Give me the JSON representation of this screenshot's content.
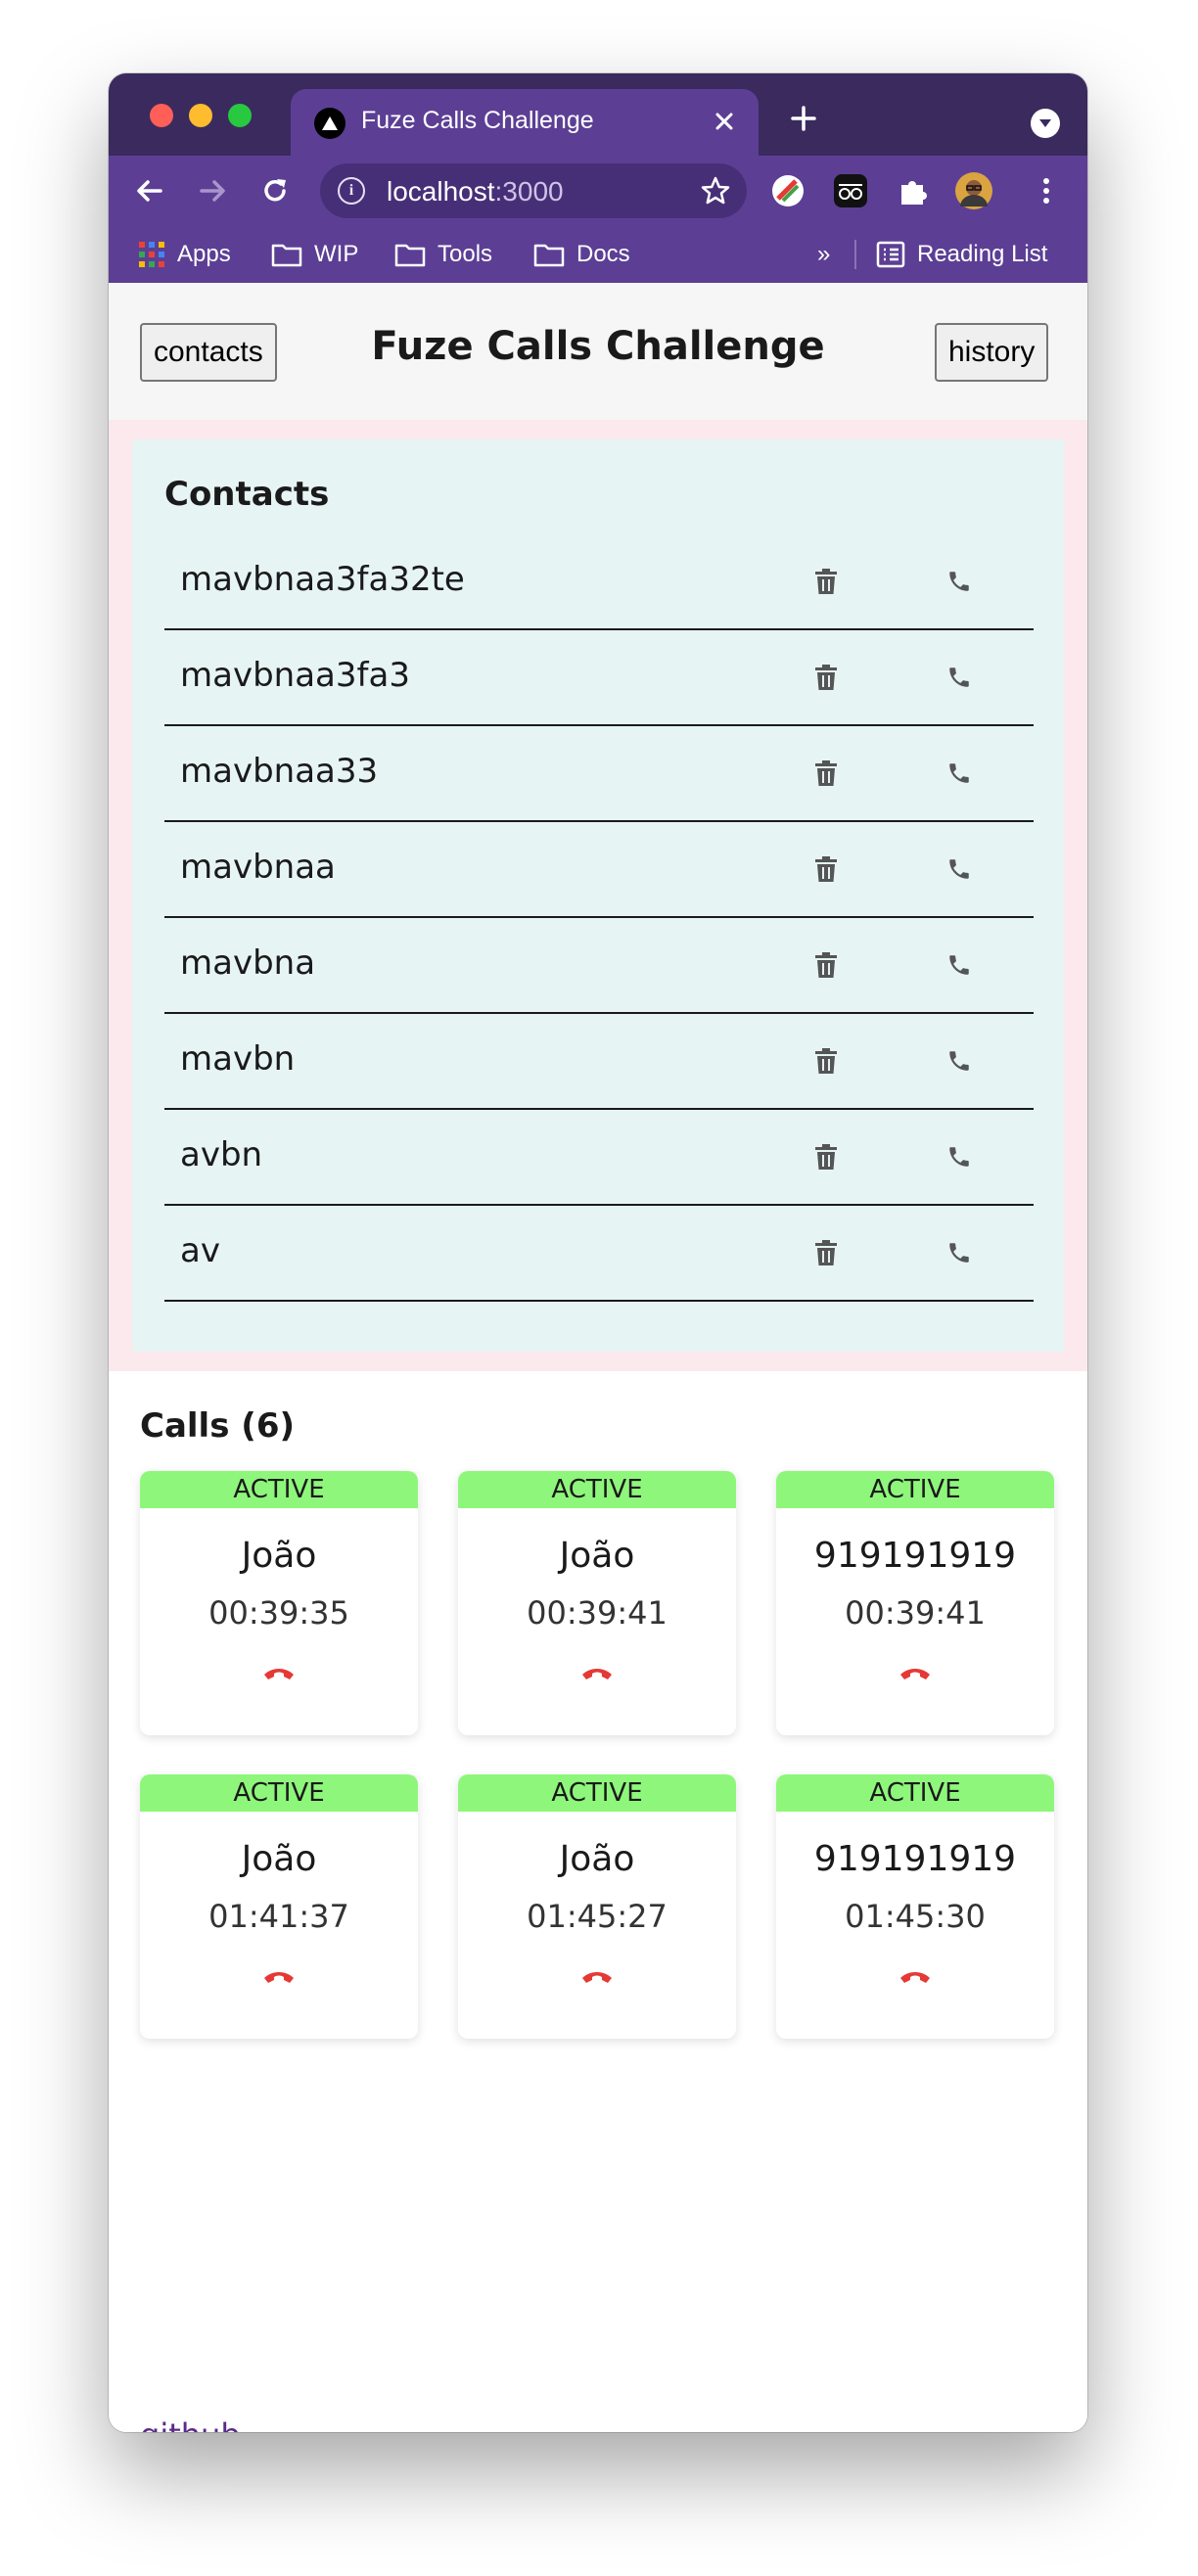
{
  "browser": {
    "tab_title": "Fuze Calls Challenge",
    "url_host": "localhost",
    "url_port": ":3000",
    "bookmarks": [
      "Apps",
      "WIP",
      "Tools",
      "Docs"
    ],
    "overflow_label": "»",
    "reading_list": "Reading List"
  },
  "header": {
    "contacts_button": "contacts",
    "title": "Fuze Calls Challenge",
    "history_button": "history"
  },
  "contacts": {
    "heading": "Contacts",
    "items": [
      {
        "name": "mavbnaa3fa32te"
      },
      {
        "name": "mavbnaa3fa3"
      },
      {
        "name": "mavbnaa33"
      },
      {
        "name": "mavbnaa"
      },
      {
        "name": "mavbna"
      },
      {
        "name": "mavbn"
      },
      {
        "name": "avbn"
      },
      {
        "name": "av"
      }
    ]
  },
  "calls": {
    "heading": "Calls (6)",
    "items": [
      {
        "status": "ACTIVE",
        "name": "João",
        "time": "00:39:35"
      },
      {
        "status": "ACTIVE",
        "name": "João",
        "time": "00:39:41"
      },
      {
        "status": "ACTIVE",
        "name": "919191919",
        "time": "00:39:41"
      },
      {
        "status": "ACTIVE",
        "name": "João",
        "time": "01:41:37"
      },
      {
        "status": "ACTIVE",
        "name": "João",
        "time": "01:45:27"
      },
      {
        "status": "ACTIVE",
        "name": "919191919",
        "time": "01:45:30"
      }
    ]
  },
  "footer": {
    "github_link": "github"
  },
  "colors": {
    "chrome_dark": "#3a2a5e",
    "chrome": "#5c3f94",
    "contacts_outer": "#fbe9ed",
    "contacts_inner": "#e7f4f4",
    "active_badge": "#8ef77b",
    "hangup_icon": "#e53935"
  },
  "icons": {
    "contact_delete": "trash-icon",
    "contact_call": "phone-icon",
    "call_hangup": "hangup-icon"
  }
}
